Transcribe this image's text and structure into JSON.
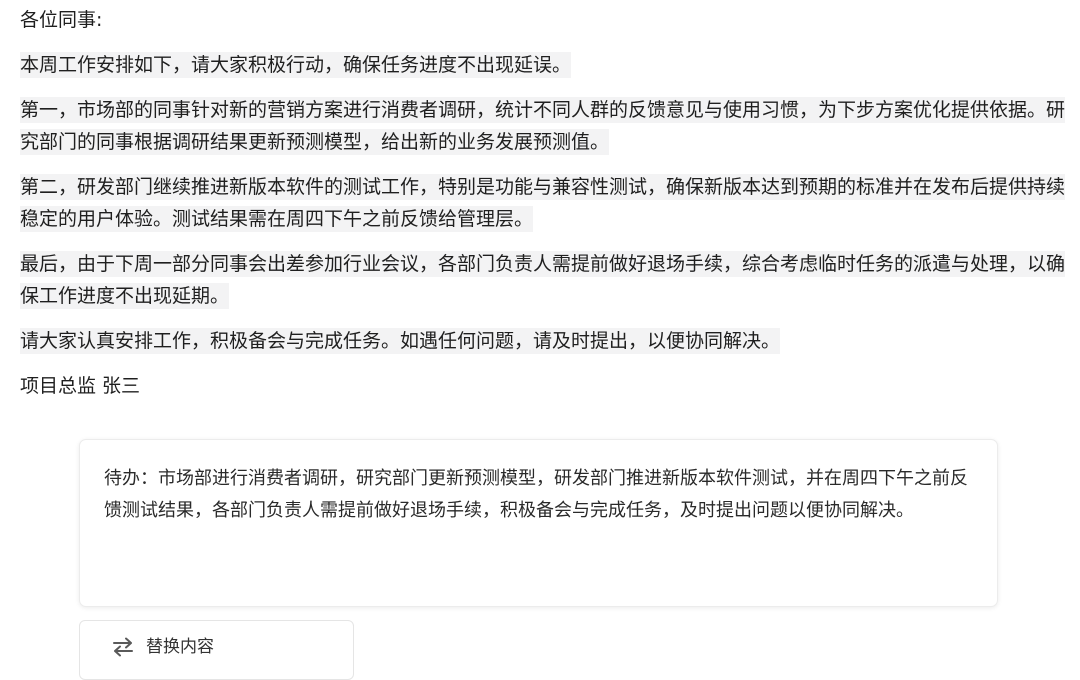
{
  "memo": {
    "greeting": "各位同事:",
    "intro": "本周工作安排如下，请大家积极行动，确保任务进度不出现延误。",
    "paragraph_1": "第一，市场部的同事针对新的营销方案进行消费者调研，统计不同人群的反馈意见与使用习惯，为下步方案优化提供依据。研究部门的同事根据调研结果更新预测模型，给出新的业务发展预测值。",
    "paragraph_2": "第二，研发部门继续推进新版本软件的测试工作，特别是功能与兼容性测试，确保新版本达到预期的标准并在发布后提供持续稳定的用户体验。测试结果需在周四下午之前反馈给管理层。",
    "paragraph_3": "最后，由于下周一部分同事会出差参加行业会议，各部门负责人需提前做好退场手续，综合考虑临时任务的派遣与处理，以确保工作进度不出现延期。",
    "closing": "请大家认真安排工作，积极备会与完成任务。如遇任何问题，请及时提出，以便协同解决。",
    "signature": "项目总监 张三"
  },
  "summary_card": {
    "text": "待办：市场部进行消费者调研，研究部门更新预测模型，研发部门推进新版本软件测试，并在周四下午之前反馈测试结果，各部门负责人需提前做好退场手续，积极备会与完成任务，及时提出问题以便协同解决。"
  },
  "replace_button": {
    "label": "替换内容",
    "icon": "swap-arrows-icon"
  }
}
